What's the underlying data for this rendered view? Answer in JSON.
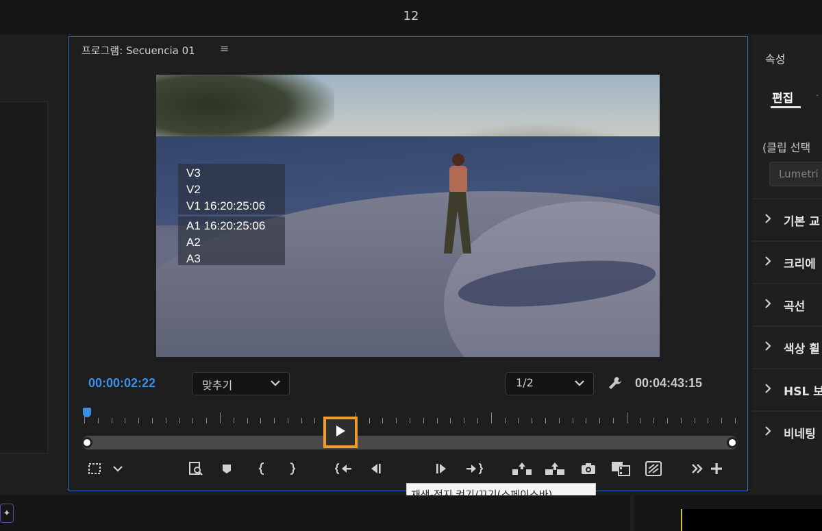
{
  "window": {
    "title": "12"
  },
  "program_monitor": {
    "title": "프로그램: Secuencia 01",
    "menu_icon": "hamburger-menu-icon",
    "overlay_video_tracks": [
      "V3",
      "V2",
      "V1 16:20:25:06"
    ],
    "overlay_audio_tracks": [
      "A1 16:20:25:06",
      "A2",
      "A3"
    ],
    "current_timecode": "00:00:02:22",
    "fit_dropdown": "맞추기",
    "resolution_dropdown": "1/2",
    "duration_timecode": "00:04:43:15",
    "colors": {
      "accent": "#3d8ee6",
      "highlight": "#f29b2f",
      "panel_border": "#2f6fc4"
    },
    "controls": [
      {
        "name": "safe-margins-icon"
      },
      {
        "name": "chevron-down-icon"
      },
      {
        "name": "zoom-frame-icon"
      },
      {
        "name": "marker-icon"
      },
      {
        "name": "mark-in-icon"
      },
      {
        "name": "mark-out-icon"
      },
      {
        "name": "go-to-in-icon"
      },
      {
        "name": "step-back-icon"
      },
      {
        "name": "play-icon"
      },
      {
        "name": "step-forward-icon"
      },
      {
        "name": "go-to-out-icon"
      },
      {
        "name": "lift-icon"
      },
      {
        "name": "extract-icon"
      },
      {
        "name": "export-frame-icon"
      },
      {
        "name": "insert-icon"
      },
      {
        "name": "overwrite-icon"
      },
      {
        "name": "more-icon"
      },
      {
        "name": "add-icon"
      }
    ],
    "tooltip": "재생-정지 켜기/끄기(스페이스바)"
  },
  "properties_panel": {
    "title": "속성",
    "active_tab": "편집",
    "clip_label": "(클립 선택",
    "lumetri_button": "Lumetri",
    "sections": [
      "기본 교",
      "크리에",
      "곡선",
      "색상 휠",
      "HSL 보",
      "비네팅"
    ]
  }
}
